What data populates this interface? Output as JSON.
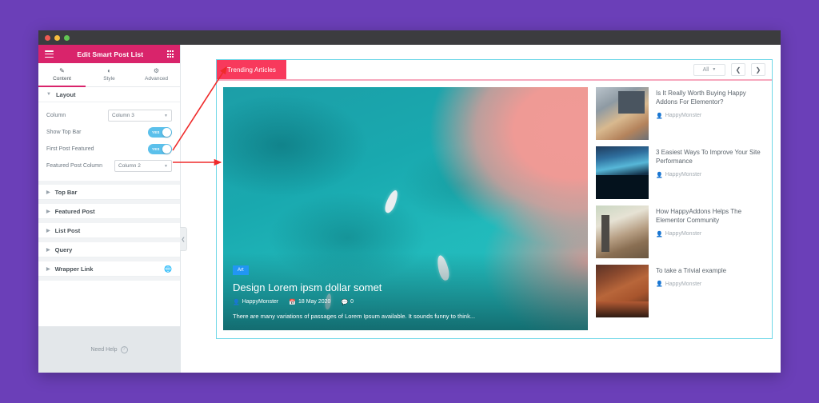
{
  "panel": {
    "header": {
      "title": "Edit Smart Post List",
      "menu_icon": "hamburger-icon",
      "grid_icon": "grid-icon"
    },
    "tabs": [
      {
        "label": "Content",
        "icon": "pencil-icon",
        "glyph": "✎",
        "active": true
      },
      {
        "label": "Style",
        "icon": "contrast-icon",
        "glyph": "◐",
        "active": false
      },
      {
        "label": "Advanced",
        "icon": "gear-icon",
        "glyph": "⚙",
        "active": false
      }
    ],
    "layout_section": {
      "title": "Layout",
      "controls": {
        "column_label": "Column",
        "column_value": "Column 3",
        "show_top_bar_label": "Show Top Bar",
        "show_top_bar_value": "YES",
        "first_post_featured_label": "First Post Featured",
        "first_post_featured_value": "YES",
        "featured_post_column_label": "Featured Post Column",
        "featured_post_column_value": "Column 2"
      }
    },
    "sections": [
      {
        "title": "Top Bar",
        "icon": null
      },
      {
        "title": "Featured Post",
        "icon": null
      },
      {
        "title": "List Post",
        "icon": null
      },
      {
        "title": "Query",
        "icon": null
      },
      {
        "title": "Wrapper Link",
        "icon": "globe-icon"
      }
    ],
    "footer": {
      "need_help": "Need Help",
      "help_icon": "question-circle-icon"
    },
    "collapse_icon": "chevron-left-icon"
  },
  "topbar": {
    "tab_label": "Trending Articles",
    "filter_value": "All",
    "prev_icon": "chevron-left-icon",
    "next_icon": "chevron-right-icon"
  },
  "featured": {
    "category": "Art",
    "title": "Design Lorem ipsm dollar somet",
    "author": "HappyMonster",
    "date": "18 May 2020",
    "comments": "0",
    "excerpt": "There are many variations of passages of Lorem Ipsum available. It sounds funny to think...",
    "author_icon": "user-icon",
    "date_icon": "calendar-icon",
    "comment_icon": "comment-icon"
  },
  "list_posts": [
    {
      "title": "Is It Really Worth Buying Happy Addons For Elementor?",
      "author": "HappyMonster",
      "thumb_class": "t1"
    },
    {
      "title": "3 Easiest Ways To Improve Your Site Performance",
      "author": "HappyMonster",
      "thumb_class": "t2"
    },
    {
      "title": "How HappyAddons Helps The Elementor Community",
      "author": "HappyMonster",
      "thumb_class": "t3"
    },
    {
      "title": "To take a Trivial example",
      "author": "HappyMonster",
      "thumb_class": "t4"
    }
  ],
  "colors": {
    "background": "#6b3fb8",
    "panel_header": "#d9246b",
    "topbar_tab": "#f8395c",
    "toggle_on": "#5bc0eb",
    "badge": "#2196f3",
    "selection_border": "#6fd8e8",
    "annotation_arrow": "#ef2b2b"
  }
}
